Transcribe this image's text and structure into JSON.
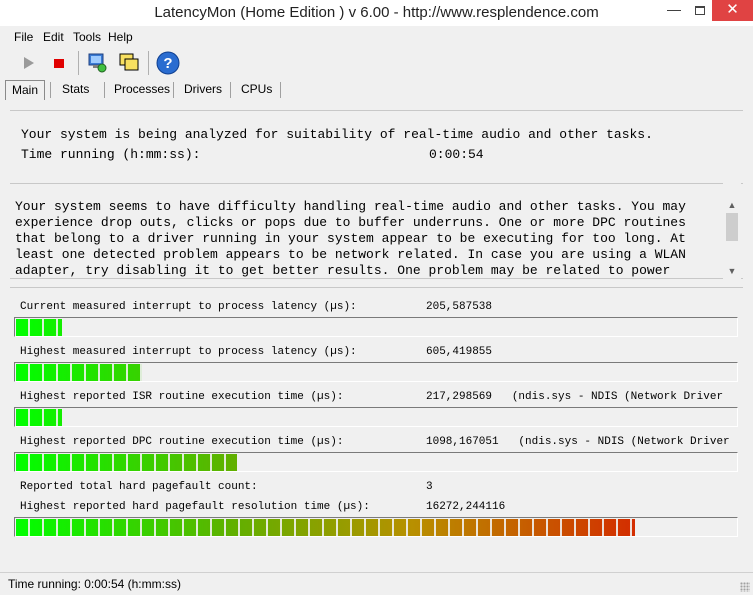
{
  "window": {
    "title": "LatencyMon  (Home Edition  )  v 6.00 - http://www.resplendence.com",
    "minimize": "—",
    "close": "✕"
  },
  "menu": [
    "File",
    "Edit",
    "Tools",
    "Help"
  ],
  "toolbar": {
    "icons": [
      "play-icon",
      "stop-icon",
      "analyze-icon",
      "windows-icon",
      "help-icon"
    ],
    "help_glyph": "?"
  },
  "tabs": [
    "Main",
    "Stats",
    "Processes",
    "Drivers",
    "CPUs"
  ],
  "status_panel": {
    "analyzing_text": "Your system is being analyzed for suitability of real-time audio and other tasks.",
    "time_label": "Time running (h:mm:ss):",
    "time_value": "0:00:54"
  },
  "message": "Your system seems to have difficulty handling real-time audio and other tasks. You may experience drop outs, clicks or pops due to buffer underruns. One or more DPC routines that belong to a driver running in your system appear to be executing for too long. At least one detected problem appears to be network related. In case you are using a WLAN adapter, try disabling it to get better results. One problem may be related to power",
  "metrics": [
    {
      "label": "Current measured interrupt to process latency (µs):",
      "value": "205,587538",
      "bar_fraction": 0.064
    },
    {
      "label": "Highest measured interrupt to process latency (µs):",
      "value": "605,419855",
      "bar_fraction": 0.175
    },
    {
      "label": "Highest reported ISR routine execution time (µs):",
      "value": "217,298569   (ndis.sys - NDIS (Network Driver",
      "bar_fraction": 0.064
    },
    {
      "label": "Highest reported DPC routine execution time (µs):",
      "value": "1098,167051   (ndis.sys - NDIS (Network Driver",
      "bar_fraction": 0.307
    },
    {
      "label": "Reported total hard pagefault count:",
      "value": "3"
    },
    {
      "label": "Highest reported hard pagefault resolution time (µs):",
      "value": "16272,244116",
      "bar_fraction": 0.86
    }
  ],
  "statusbar": {
    "text": "Time running: 0:00:54  (h:mm:ss)"
  },
  "colors": {
    "bar_green": "#00ff00",
    "bar_red": "#e00000",
    "close_button": "#e04343"
  }
}
